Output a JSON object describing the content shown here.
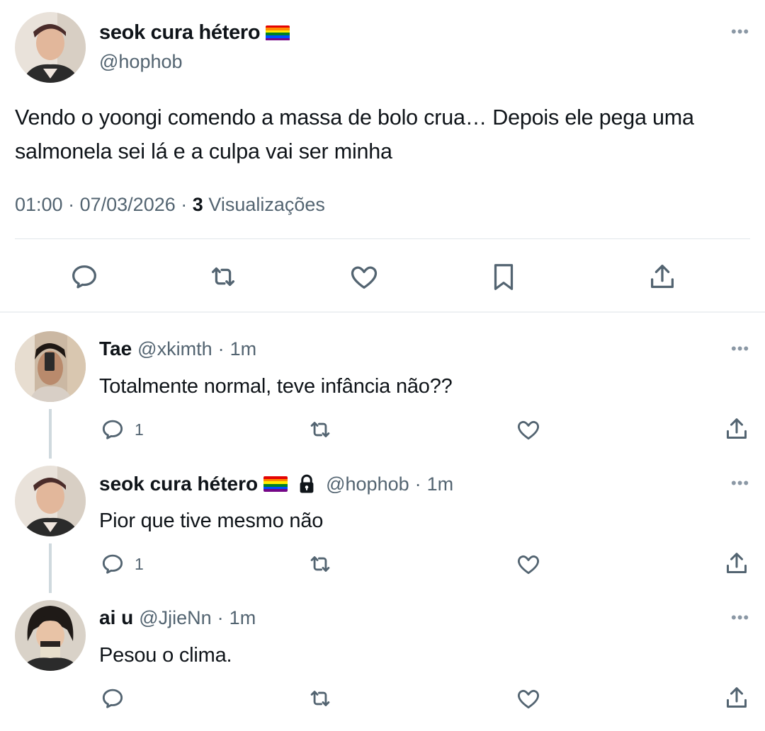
{
  "main_tweet": {
    "display_name": "seok cura hétero",
    "handle": "@hophob",
    "text": "Vendo o yoongi comendo a massa de bolo crua… Depois ele pega uma salmonela sei lá e a culpa vai ser minha",
    "time": "01:00",
    "date": "07/03/2026",
    "views_count": "3",
    "views_label": "Visualizações",
    "more": "•••"
  },
  "replies": [
    {
      "display_name": "Tae",
      "handle": "@xkimth",
      "time": "1m",
      "text": "Totalmente normal, teve infância não??",
      "reply_count": "1",
      "more": "•••"
    },
    {
      "display_name": "seok cura hétero",
      "handle": "@hophob",
      "time": "1m",
      "text": "Pior que tive mesmo não",
      "reply_count": "1",
      "more": "•••"
    },
    {
      "display_name": "ai u",
      "handle": "@JjieNn",
      "time": "1m",
      "text": "Pesou o clima.",
      "reply_count": "",
      "more": "•••"
    }
  ],
  "separator": "·",
  "icons": {
    "reply": "reply-icon",
    "retweet": "retweet-icon",
    "like": "heart-icon",
    "bookmark": "bookmark-icon",
    "share": "share-icon",
    "flag": "rainbow-flag-icon",
    "lock": "lock-icon"
  },
  "colors": {
    "text": "#0f1419",
    "secondary": "#536471",
    "icon": "#536471",
    "divider": "#e1e6ea",
    "thread_line": "#cfd9de"
  }
}
